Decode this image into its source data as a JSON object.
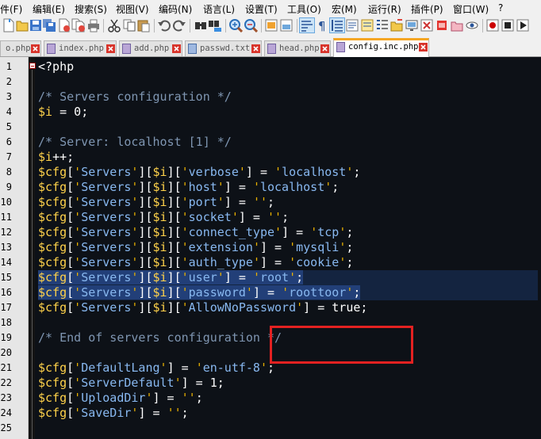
{
  "menu": [
    "件(F)",
    "编辑(E)",
    "搜索(S)",
    "视图(V)",
    "编码(N)",
    "语言(L)",
    "设置(T)",
    "工具(O)",
    "宏(M)",
    "运行(R)",
    "插件(P)",
    "窗口(W)",
    "?"
  ],
  "tabs": [
    {
      "label": "o.php"
    },
    {
      "label": "index.php"
    },
    {
      "label": "add.php"
    },
    {
      "label": "passwd.txt"
    },
    {
      "label": "head.php"
    },
    {
      "label": "config.inc.php",
      "active": true
    }
  ],
  "toolbar_icons": [
    "new-file-icon",
    "open-file-icon",
    "save-icon",
    "save-all-icon",
    "close-file-icon",
    "close-all-icon",
    "print-icon",
    "cut-icon",
    "copy-icon",
    "paste-icon",
    "undo-icon",
    "redo-icon",
    "find-icon",
    "replace-icon",
    "zoom-in-icon",
    "zoom-out-icon",
    "sync-vertical-icon",
    "sync-horizontal-icon",
    "word-wrap-icon",
    "show-all-chars-icon",
    "indent-guide-icon",
    "language-icon",
    "doc-map-icon",
    "function-list-icon",
    "folder-workspace-icon",
    "monitor-icon",
    "record-macro-icon",
    "stop-record-icon"
  ],
  "code_lines": [
    {
      "n": "1",
      "code": "<?php"
    },
    {
      "n": "2",
      "code": ""
    },
    {
      "n": "3",
      "code": "/* Servers configuration */"
    },
    {
      "n": "4",
      "code": "$i = 0;"
    },
    {
      "n": "5",
      "code": ""
    },
    {
      "n": "6",
      "code": "/* Server: localhost [1] */"
    },
    {
      "n": "7",
      "code": "$i++;"
    },
    {
      "n": "8",
      "code": "$cfg['Servers'][$i]['verbose'] = 'localhost';"
    },
    {
      "n": "9",
      "code": "$cfg['Servers'][$i]['host'] = 'localhost';"
    },
    {
      "n": "10",
      "code": "$cfg['Servers'][$i]['port'] = '';"
    },
    {
      "n": "11",
      "code": "$cfg['Servers'][$i]['socket'] = '';"
    },
    {
      "n": "12",
      "code": "$cfg['Servers'][$i]['connect_type'] = 'tcp';"
    },
    {
      "n": "13",
      "code": "$cfg['Servers'][$i]['extension'] = 'mysqli';"
    },
    {
      "n": "14",
      "code": "$cfg['Servers'][$i]['auth_type'] = 'cookie';"
    },
    {
      "n": "15",
      "code": "$cfg['Servers'][$i]['user'] = 'root';",
      "selected": true
    },
    {
      "n": "16",
      "code": "$cfg['Servers'][$i]['password'] = 'roottoor';",
      "selected": true
    },
    {
      "n": "17",
      "code": "$cfg['Servers'][$i]['AllowNoPassword'] = true;"
    },
    {
      "n": "18",
      "code": ""
    },
    {
      "n": "19",
      "code": "/* End of servers configuration */"
    },
    {
      "n": "20",
      "code": ""
    },
    {
      "n": "21",
      "code": "$cfg['DefaultLang'] = 'en-utf-8';"
    },
    {
      "n": "22",
      "code": "$cfg['ServerDefault'] = 1;"
    },
    {
      "n": "23",
      "code": "$cfg['UploadDir'] = '';"
    },
    {
      "n": "24",
      "code": "$cfg['SaveDir'] = '';"
    },
    {
      "n": "25",
      "code": ""
    }
  ],
  "colors": {
    "editor_bg": "#0d1117",
    "variable": "#ffd24a",
    "string": "#88b8f0",
    "comment": "#7f96b2",
    "selection": "#223f78",
    "annotation_box": "#e32121",
    "active_tab_accent": "#f5a623"
  }
}
